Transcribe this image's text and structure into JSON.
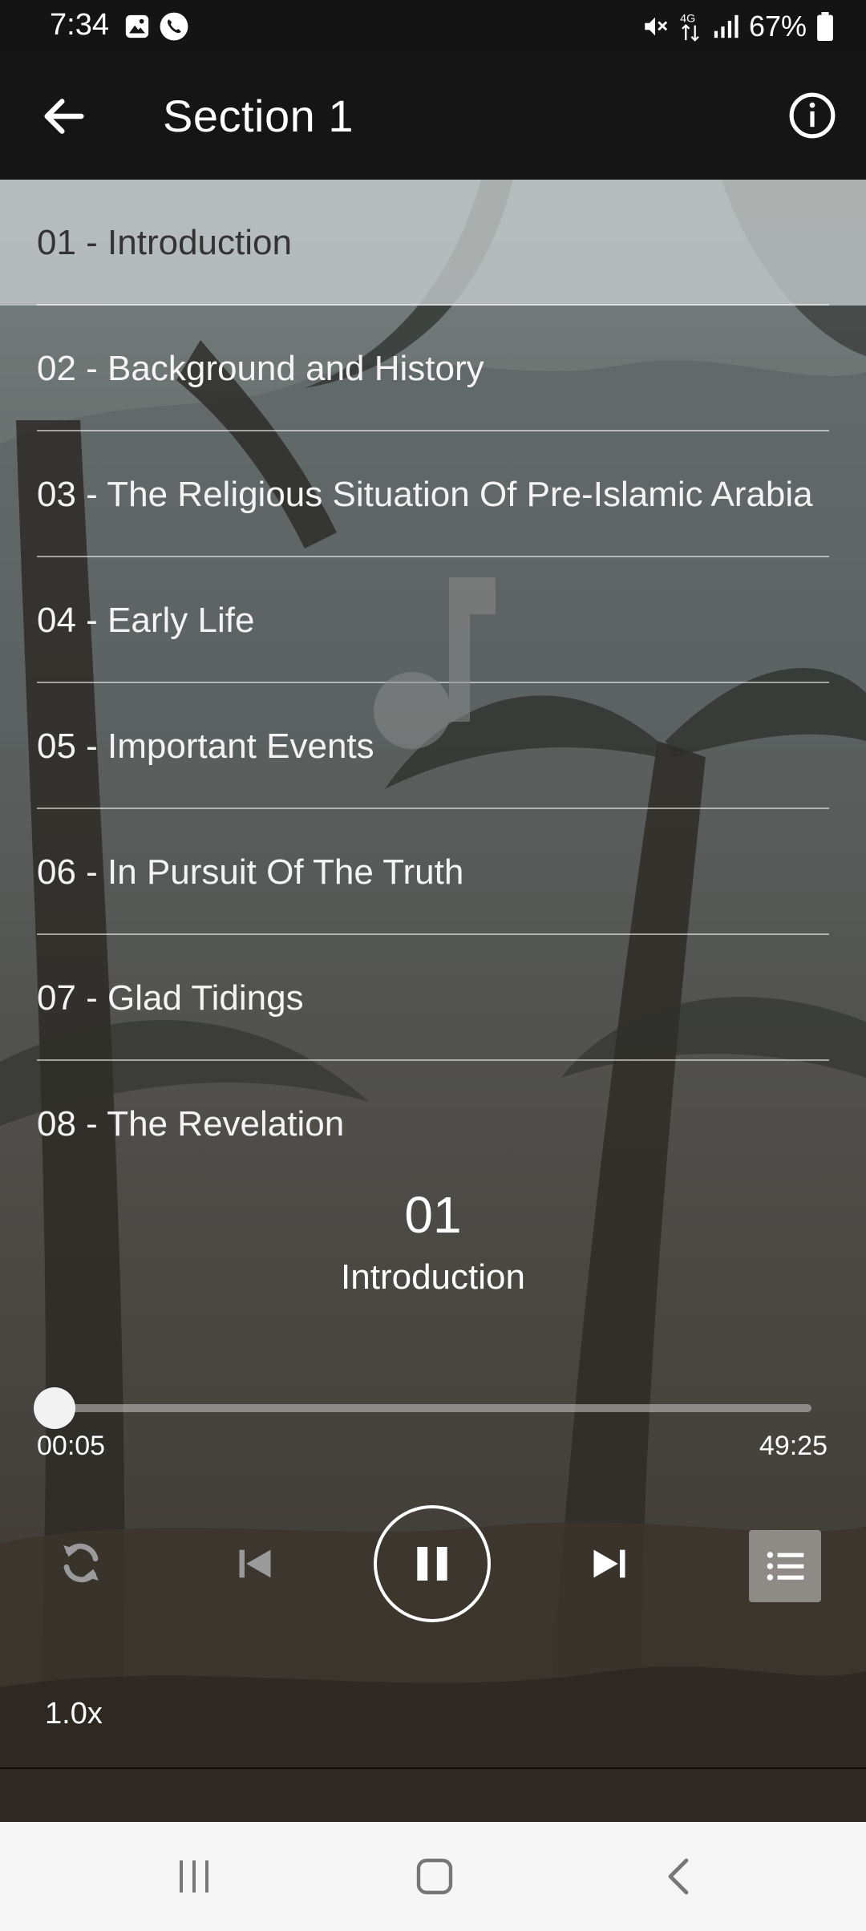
{
  "status_bar": {
    "time": "7:34",
    "battery": "67%",
    "icons": [
      "gallery-icon",
      "phone-icon",
      "mute-icon",
      "4g-icon",
      "signal-icon",
      "battery-icon"
    ]
  },
  "app_bar": {
    "title": "Section 1",
    "back_icon": "arrow-back-icon",
    "info_icon": "info-icon"
  },
  "tracks": [
    {
      "label": "01 - Introduction",
      "active": true
    },
    {
      "label": "02 - Background and History",
      "active": false
    },
    {
      "label": "03 - The Religious Situation Of Pre-Islamic Arabia",
      "active": false
    },
    {
      "label": "04 - Early Life",
      "active": false
    },
    {
      "label": "05 - Important Events",
      "active": false
    },
    {
      "label": "06 - In Pursuit Of The Truth",
      "active": false
    },
    {
      "label": "07 - Glad Tidings",
      "active": false
    },
    {
      "label": "08 - The Revelation",
      "active": false
    }
  ],
  "now_playing": {
    "number": "01",
    "title": "Introduction",
    "elapsed": "00:05",
    "total": "49:25",
    "progress_fraction": 0.0017
  },
  "controls": {
    "speed": "1.0x",
    "repeat_icon": "repeat-icon",
    "prev_icon": "skip-previous-icon",
    "play_pause_icon": "pause-icon",
    "next_icon": "skip-next-icon",
    "playlist_icon": "playlist-icon"
  },
  "colors": {
    "active_row": "#c8cdcd",
    "app_bar": "#151515",
    "nav_bar": "#f6f6f6"
  }
}
